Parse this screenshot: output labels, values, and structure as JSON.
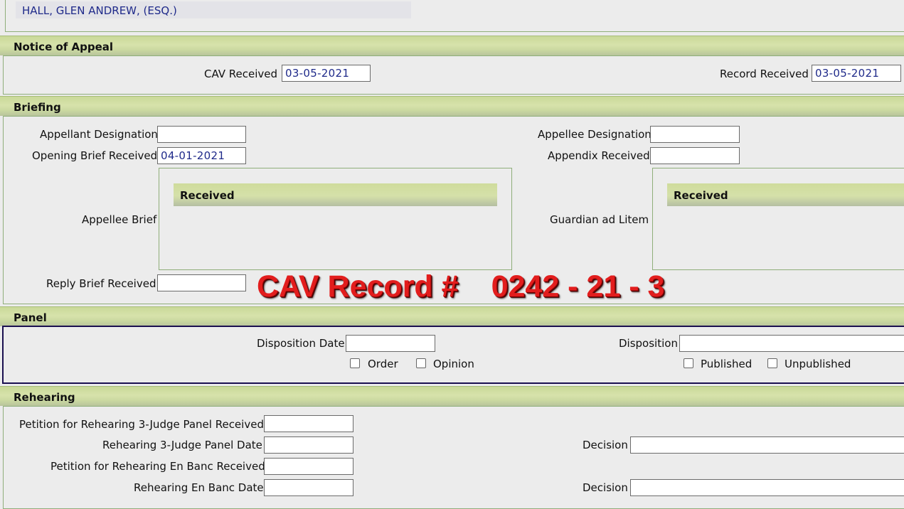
{
  "top": {
    "attorney": "HALL, GLEN ANDREW, (ESQ.)"
  },
  "notice_of_appeal": {
    "title": "Notice of Appeal",
    "cav_received_label": "CAV Received",
    "cav_received_value": "03-05-2021",
    "record_received_label": "Record Received",
    "record_received_value": "03-05-2021"
  },
  "briefing": {
    "title": "Briefing",
    "appellant_designation_label": "Appellant Designation",
    "appellant_designation_value": "",
    "opening_brief_label": "Opening Brief Received",
    "opening_brief_value": "04-01-2021",
    "appellee_brief_label": "Appellee Brief",
    "appellee_brief_header": "Received",
    "reply_brief_label": "Reply Brief Received",
    "reply_brief_value": "",
    "appellee_designation_label": "Appellee Designation",
    "appellee_designation_value": "",
    "appendix_label": "Appendix Received",
    "appendix_value": "",
    "guardian_label": "Guardian ad Litem",
    "guardian_header": "Received"
  },
  "stamp": {
    "prefix": "CAV Record #",
    "number": "0242 - 21 - 3",
    "color": "#e21d1d"
  },
  "panel": {
    "title": "Panel",
    "disposition_date_label": "Disposition Date",
    "disposition_date_value": "",
    "order_label": "Order",
    "opinion_label": "Opinion",
    "disposition_label": "Disposition",
    "disposition_value": "",
    "published_label": "Published",
    "unpublished_label": "Unpublished"
  },
  "rehearing": {
    "title": "Rehearing",
    "petition_3judge_label": "Petition for Rehearing 3-Judge Panel Received",
    "petition_3judge_value": "",
    "rehearing_3judge_date_label": "Rehearing 3-Judge Panel Date",
    "rehearing_3judge_date_value": "",
    "petition_enbanc_label": "Petition for Rehearing En Banc Received",
    "petition_enbanc_value": "",
    "rehearing_enbanc_date_label": "Rehearing En Banc Date",
    "rehearing_enbanc_date_value": "",
    "decision_label": "Decision",
    "decision_1_value": "",
    "decision_2_value": ""
  },
  "colors": {
    "section_bar": "#cfdc9c",
    "frame": "#8fae7a",
    "field_text": "#1f2a8a",
    "panel_border": "#1a1050"
  }
}
